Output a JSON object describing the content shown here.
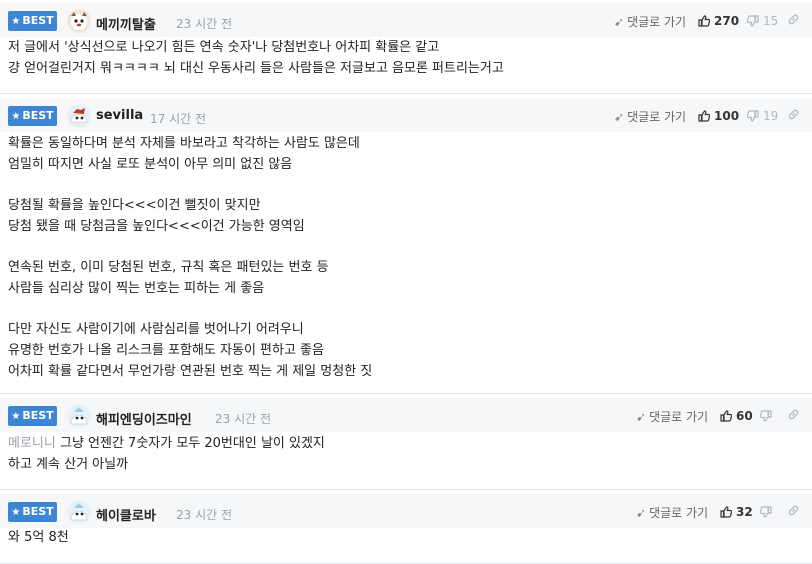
{
  "badge_label": "BEST",
  "reply_label": "댓글로 가기",
  "comments": [
    {
      "nick": "메끼끼탈출",
      "time": "23 시간 전",
      "up": "270",
      "down": "15",
      "lines": [
        "저 글에서 '상식선으로 나오기 힘든 연속 숫자'나 당첨번호나 어차피 확률은 같고",
        "걍 얻어걸린거지 뭐ㅋㅋㅋㅋ 뇌 대신 우동사리 들은 사람들은 저글보고 음모론 퍼트리는거고"
      ]
    },
    {
      "nick": "sevilla",
      "time": "17 시간 전",
      "up": "100",
      "down": "19",
      "lines": [
        "확률은 동일하다며 분석 자체를 바보라고 착각하는 사람도 많은데",
        "엄밀히 따지면 사실 로또 분석이 아무 의미 없진 않음",
        "",
        "당첨될 확률을 높인다<<<이건 뻘짓이 맞지만",
        "당첨 됐을 때 당첨금을 높인다<<<이건 가능한 영역임",
        "",
        "연속된 번호, 이미 당첨된 번호, 규칙 혹은 패턴있는 번호 등",
        "사람들 심리상 많이 찍는 번호는 피하는 게 좋음",
        "",
        "다만 자신도 사람이기에 사람심리를 벗어나기 어려우니",
        "유명한 번호가 나올 리스크를 포함해도 자동이 편하고 좋음",
        "어차피 확률 같다면서 무언가랑 연관된 번호 찍는 게 제일 멍청한 짓"
      ]
    },
    {
      "nick": "해피엔딩이즈마인",
      "time": "23 시간 전",
      "up": "60",
      "mention": "메로니니",
      "lines": [
        "그냥 언젠간 7숫자가 모두 20번대인 날이 있겠지",
        "하고 계속 산거 아닐까"
      ]
    },
    {
      "nick": "헤이클로바",
      "time": "23 시간 전",
      "up": "32",
      "lines": [
        "와 5억 8천"
      ]
    }
  ]
}
